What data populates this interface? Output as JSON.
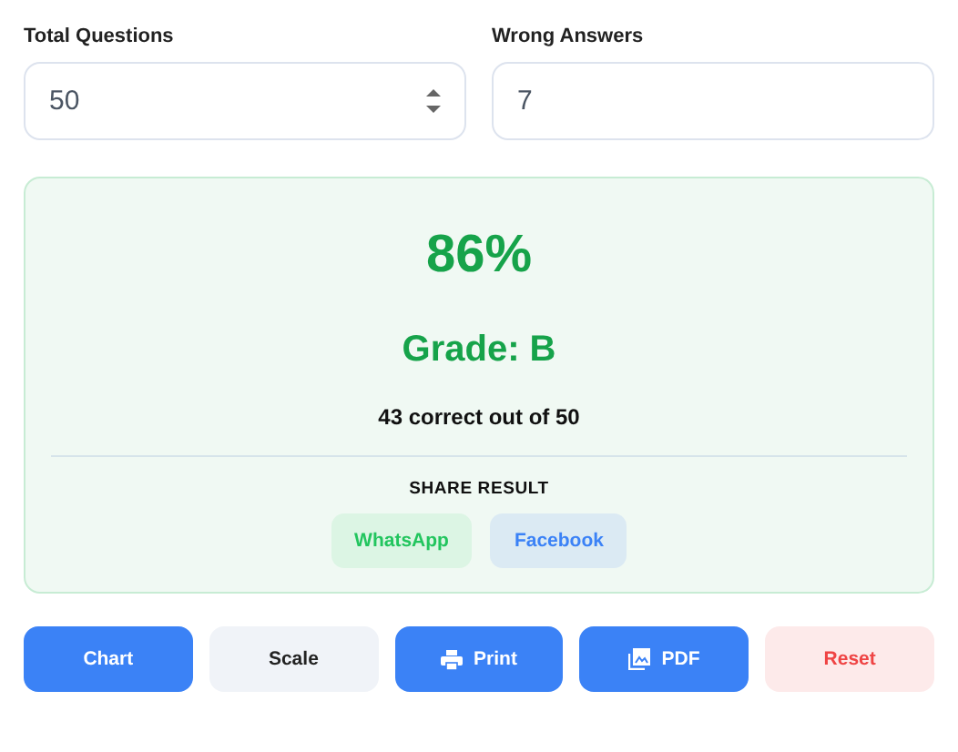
{
  "fields": [
    {
      "label": "Total Questions",
      "value": "50",
      "kind": "number"
    },
    {
      "label": "Wrong Answers",
      "value": "7",
      "kind": "text"
    }
  ],
  "result": {
    "percent": "86%",
    "grade": "Grade: B",
    "summary": "43 correct out of 50",
    "share_title": "SHARE RESULT",
    "share_buttons": [
      {
        "label": "WhatsApp",
        "kind": "whatsapp"
      },
      {
        "label": "Facebook",
        "kind": "facebook"
      }
    ]
  },
  "actions": [
    {
      "label": "Chart",
      "kind": "primary"
    },
    {
      "label": "Scale",
      "kind": "secondary"
    },
    {
      "label": "Print",
      "kind": "print"
    },
    {
      "label": "PDF",
      "kind": "pdf"
    },
    {
      "label": "Reset",
      "kind": "danger"
    }
  ]
}
